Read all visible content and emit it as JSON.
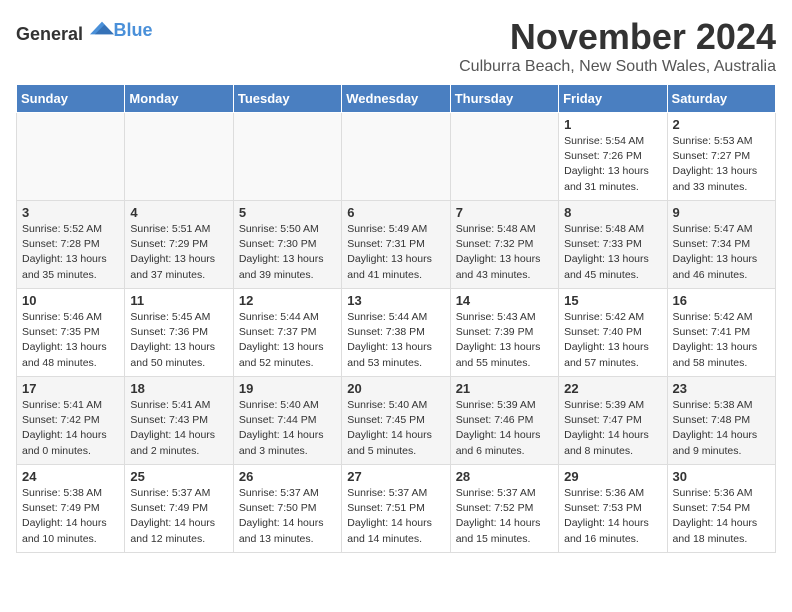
{
  "logo": {
    "general": "General",
    "blue": "Blue"
  },
  "title": {
    "month": "November 2024",
    "location": "Culburra Beach, New South Wales, Australia"
  },
  "weekdays": [
    "Sunday",
    "Monday",
    "Tuesday",
    "Wednesday",
    "Thursday",
    "Friday",
    "Saturday"
  ],
  "weeks": [
    [
      {
        "day": "",
        "info": ""
      },
      {
        "day": "",
        "info": ""
      },
      {
        "day": "",
        "info": ""
      },
      {
        "day": "",
        "info": ""
      },
      {
        "day": "",
        "info": ""
      },
      {
        "day": "1",
        "info": "Sunrise: 5:54 AM\nSunset: 7:26 PM\nDaylight: 13 hours\nand 31 minutes."
      },
      {
        "day": "2",
        "info": "Sunrise: 5:53 AM\nSunset: 7:27 PM\nDaylight: 13 hours\nand 33 minutes."
      }
    ],
    [
      {
        "day": "3",
        "info": "Sunrise: 5:52 AM\nSunset: 7:28 PM\nDaylight: 13 hours\nand 35 minutes."
      },
      {
        "day": "4",
        "info": "Sunrise: 5:51 AM\nSunset: 7:29 PM\nDaylight: 13 hours\nand 37 minutes."
      },
      {
        "day": "5",
        "info": "Sunrise: 5:50 AM\nSunset: 7:30 PM\nDaylight: 13 hours\nand 39 minutes."
      },
      {
        "day": "6",
        "info": "Sunrise: 5:49 AM\nSunset: 7:31 PM\nDaylight: 13 hours\nand 41 minutes."
      },
      {
        "day": "7",
        "info": "Sunrise: 5:48 AM\nSunset: 7:32 PM\nDaylight: 13 hours\nand 43 minutes."
      },
      {
        "day": "8",
        "info": "Sunrise: 5:48 AM\nSunset: 7:33 PM\nDaylight: 13 hours\nand 45 minutes."
      },
      {
        "day": "9",
        "info": "Sunrise: 5:47 AM\nSunset: 7:34 PM\nDaylight: 13 hours\nand 46 minutes."
      }
    ],
    [
      {
        "day": "10",
        "info": "Sunrise: 5:46 AM\nSunset: 7:35 PM\nDaylight: 13 hours\nand 48 minutes."
      },
      {
        "day": "11",
        "info": "Sunrise: 5:45 AM\nSunset: 7:36 PM\nDaylight: 13 hours\nand 50 minutes."
      },
      {
        "day": "12",
        "info": "Sunrise: 5:44 AM\nSunset: 7:37 PM\nDaylight: 13 hours\nand 52 minutes."
      },
      {
        "day": "13",
        "info": "Sunrise: 5:44 AM\nSunset: 7:38 PM\nDaylight: 13 hours\nand 53 minutes."
      },
      {
        "day": "14",
        "info": "Sunrise: 5:43 AM\nSunset: 7:39 PM\nDaylight: 13 hours\nand 55 minutes."
      },
      {
        "day": "15",
        "info": "Sunrise: 5:42 AM\nSunset: 7:40 PM\nDaylight: 13 hours\nand 57 minutes."
      },
      {
        "day": "16",
        "info": "Sunrise: 5:42 AM\nSunset: 7:41 PM\nDaylight: 13 hours\nand 58 minutes."
      }
    ],
    [
      {
        "day": "17",
        "info": "Sunrise: 5:41 AM\nSunset: 7:42 PM\nDaylight: 14 hours\nand 0 minutes."
      },
      {
        "day": "18",
        "info": "Sunrise: 5:41 AM\nSunset: 7:43 PM\nDaylight: 14 hours\nand 2 minutes."
      },
      {
        "day": "19",
        "info": "Sunrise: 5:40 AM\nSunset: 7:44 PM\nDaylight: 14 hours\nand 3 minutes."
      },
      {
        "day": "20",
        "info": "Sunrise: 5:40 AM\nSunset: 7:45 PM\nDaylight: 14 hours\nand 5 minutes."
      },
      {
        "day": "21",
        "info": "Sunrise: 5:39 AM\nSunset: 7:46 PM\nDaylight: 14 hours\nand 6 minutes."
      },
      {
        "day": "22",
        "info": "Sunrise: 5:39 AM\nSunset: 7:47 PM\nDaylight: 14 hours\nand 8 minutes."
      },
      {
        "day": "23",
        "info": "Sunrise: 5:38 AM\nSunset: 7:48 PM\nDaylight: 14 hours\nand 9 minutes."
      }
    ],
    [
      {
        "day": "24",
        "info": "Sunrise: 5:38 AM\nSunset: 7:49 PM\nDaylight: 14 hours\nand 10 minutes."
      },
      {
        "day": "25",
        "info": "Sunrise: 5:37 AM\nSunset: 7:49 PM\nDaylight: 14 hours\nand 12 minutes."
      },
      {
        "day": "26",
        "info": "Sunrise: 5:37 AM\nSunset: 7:50 PM\nDaylight: 14 hours\nand 13 minutes."
      },
      {
        "day": "27",
        "info": "Sunrise: 5:37 AM\nSunset: 7:51 PM\nDaylight: 14 hours\nand 14 minutes."
      },
      {
        "day": "28",
        "info": "Sunrise: 5:37 AM\nSunset: 7:52 PM\nDaylight: 14 hours\nand 15 minutes."
      },
      {
        "day": "29",
        "info": "Sunrise: 5:36 AM\nSunset: 7:53 PM\nDaylight: 14 hours\nand 16 minutes."
      },
      {
        "day": "30",
        "info": "Sunrise: 5:36 AM\nSunset: 7:54 PM\nDaylight: 14 hours\nand 18 minutes."
      }
    ]
  ]
}
